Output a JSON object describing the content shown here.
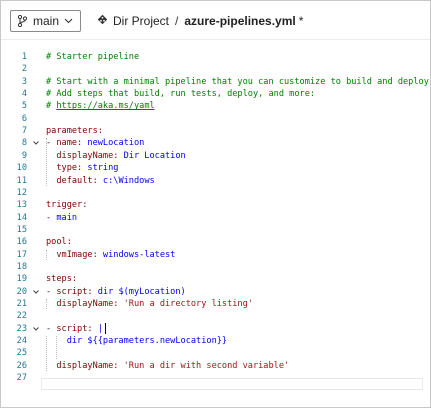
{
  "toolbar": {
    "branch": "main",
    "project": "Dir Project",
    "separator": "/",
    "file": "azure-pipelines.yml",
    "modified_marker": "*"
  },
  "editor": {
    "lines": [
      {
        "n": "1",
        "parts": [
          {
            "t": "# Starter pipeline",
            "c": "c-comment"
          }
        ]
      },
      {
        "n": "2",
        "parts": []
      },
      {
        "n": "3",
        "parts": [
          {
            "t": "# Start with a minimal pipeline that you can customize to build and deploy yo",
            "c": "c-comment"
          }
        ]
      },
      {
        "n": "4",
        "parts": [
          {
            "t": "# Add steps that build, run tests, deploy, and more:",
            "c": "c-comment"
          }
        ]
      },
      {
        "n": "5",
        "parts": [
          {
            "t": "# ",
            "c": "c-comment"
          },
          {
            "t": "https://aka.ms/yaml",
            "c": "c-link"
          }
        ]
      },
      {
        "n": "6",
        "parts": []
      },
      {
        "n": "7",
        "parts": [
          {
            "t": "parameters:",
            "c": "c-key"
          }
        ]
      },
      {
        "n": "8",
        "parts": [
          {
            "t": "- ",
            "c": "c-dash"
          },
          {
            "t": "name:",
            "c": "c-key"
          },
          {
            "t": " newLocation",
            "c": "c-val"
          }
        ]
      },
      {
        "n": "9",
        "parts": [
          {
            "t": "  displayName:",
            "c": "c-key"
          },
          {
            "t": " Dir Location",
            "c": "c-val"
          }
        ]
      },
      {
        "n": "10",
        "parts": [
          {
            "t": "  type:",
            "c": "c-key"
          },
          {
            "t": " string",
            "c": "c-val"
          }
        ]
      },
      {
        "n": "11",
        "parts": [
          {
            "t": "  default:",
            "c": "c-key"
          },
          {
            "t": " c:\\Windows",
            "c": "c-val"
          }
        ]
      },
      {
        "n": "12",
        "parts": []
      },
      {
        "n": "13",
        "parts": [
          {
            "t": "trigger:",
            "c": "c-key"
          }
        ]
      },
      {
        "n": "14",
        "parts": [
          {
            "t": "- ",
            "c": "c-dash"
          },
          {
            "t": "main",
            "c": "c-val"
          }
        ]
      },
      {
        "n": "15",
        "parts": []
      },
      {
        "n": "16",
        "parts": [
          {
            "t": "pool:",
            "c": "c-key"
          }
        ]
      },
      {
        "n": "17",
        "parts": [
          {
            "t": "  vmImage:",
            "c": "c-key"
          },
          {
            "t": " windows-latest",
            "c": "c-val"
          }
        ]
      },
      {
        "n": "18",
        "parts": []
      },
      {
        "n": "19",
        "parts": [
          {
            "t": "steps:",
            "c": "c-key"
          }
        ]
      },
      {
        "n": "20",
        "parts": [
          {
            "t": "- ",
            "c": "c-dash"
          },
          {
            "t": "script:",
            "c": "c-key"
          },
          {
            "t": " dir $(myLocation)",
            "c": "c-val"
          }
        ]
      },
      {
        "n": "21",
        "parts": [
          {
            "t": "  displayName:",
            "c": "c-key"
          },
          {
            "t": " 'Run a directory listing'",
            "c": "c-str"
          }
        ]
      },
      {
        "n": "22",
        "parts": []
      },
      {
        "n": "23",
        "parts": [
          {
            "t": "- ",
            "c": "c-dash"
          },
          {
            "t": "script:",
            "c": "c-key"
          },
          {
            "t": " |",
            "c": "c-val"
          }
        ]
      },
      {
        "n": "24",
        "parts": [
          {
            "t": "    dir ${{parameters.newLocation}}",
            "c": "c-val"
          }
        ]
      },
      {
        "n": "25",
        "parts": [
          {
            "t": "    ",
            "c": "c-val"
          }
        ]
      },
      {
        "n": "26",
        "parts": [
          {
            "t": "  displayName:",
            "c": "c-key"
          },
          {
            "t": " 'Run a dir with second variable'",
            "c": "c-str"
          }
        ]
      },
      {
        "n": "27",
        "parts": []
      }
    ]
  }
}
